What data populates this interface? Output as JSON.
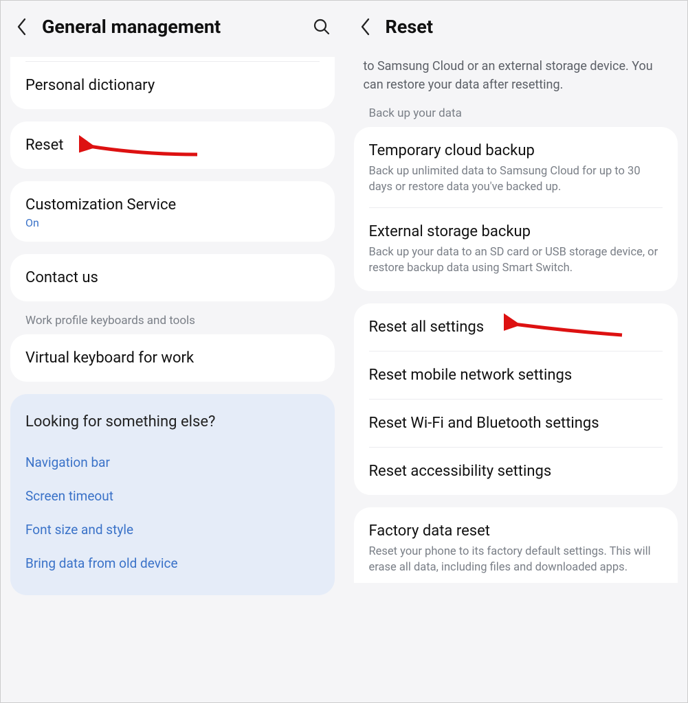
{
  "left": {
    "title": "General management",
    "items": {
      "personal_dictionary": "Personal dictionary",
      "reset": "Reset",
      "customization_service": {
        "label": "Customization Service",
        "status": "On"
      },
      "contact_us": "Contact us"
    },
    "work_section_label": "Work profile keyboards and tools",
    "work_items": {
      "virtual_keyboard": "Virtual keyboard for work"
    },
    "suggest": {
      "title": "Looking for something else?",
      "links": {
        "nav_bar": "Navigation bar",
        "screen_timeout": "Screen timeout",
        "font": "Font size and style",
        "bring_data": "Bring data from old device"
      }
    }
  },
  "right": {
    "title": "Reset",
    "intro": "to Samsung Cloud or an external storage device. You can restore your data after resetting.",
    "backup_section_label": "Back up your data",
    "backup_items": {
      "temp_cloud": {
        "label": "Temporary cloud backup",
        "desc": "Back up unlimited data to Samsung Cloud for up to 30 days or restore data you've backed up."
      },
      "ext_storage": {
        "label": "External storage backup",
        "desc": "Back up your data to an SD card or USB storage device, or restore backup data using Smart Switch."
      }
    },
    "reset_items": {
      "all": "Reset all settings",
      "mobile": "Reset mobile network settings",
      "wifi_bt": "Reset Wi-Fi and Bluetooth settings",
      "accessibility": "Reset accessibility settings"
    },
    "factory": {
      "label": "Factory data reset",
      "desc": "Reset your phone to its factory default settings. This will erase all data, including files and downloaded apps."
    }
  }
}
